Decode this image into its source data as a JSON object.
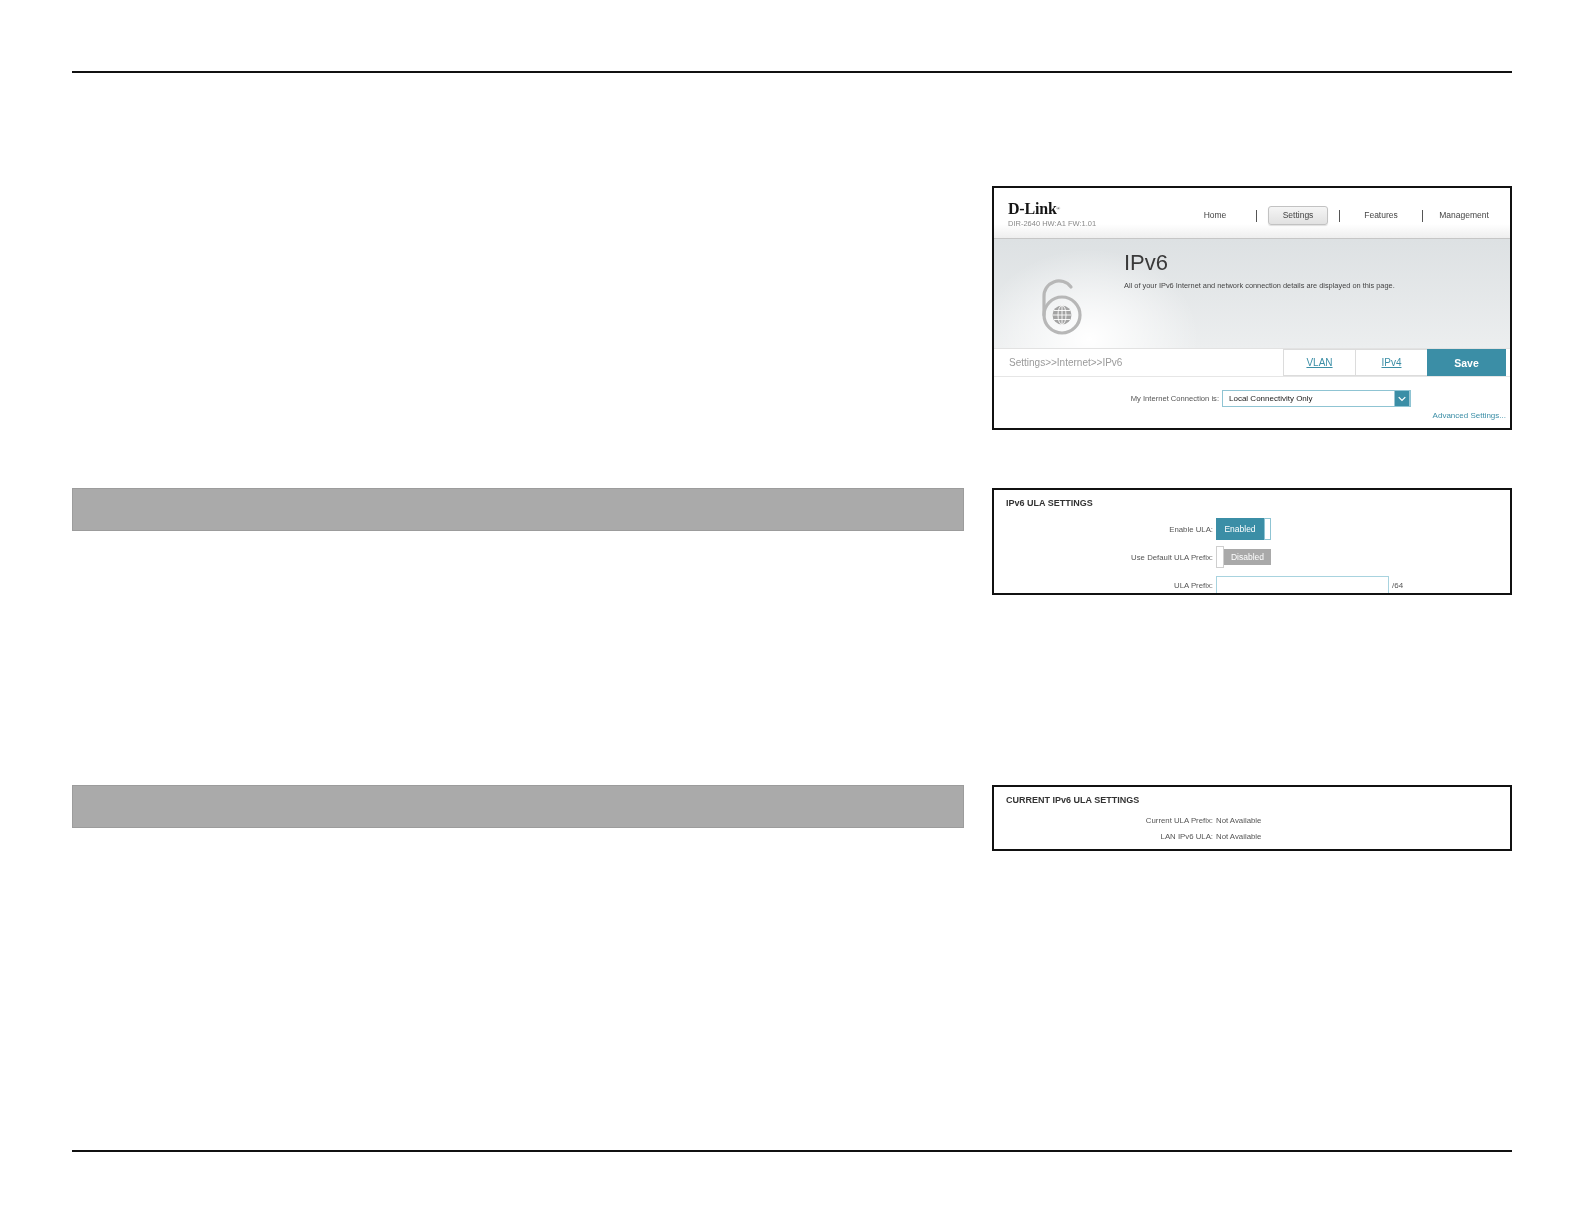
{
  "router_ui": {
    "header": {
      "logo": "D-Link$^{®}$",
      "model": "DIR-2640 HW:A1 FW:1.01",
      "nav": [
        {
          "label": "Home",
          "selected": false
        },
        {
          "label": "Settings",
          "selected": true
        },
        {
          "label": "Features",
          "selected": false
        },
        {
          "label": "Management",
          "selected": false
        }
      ]
    },
    "banner": {
      "title": "IPv6",
      "description": "All of your IPv6 Internet and network connection details are displayed on this page."
    },
    "breadcrumb": "Settings>>Internet>>IPv6",
    "sub_pages": [
      {
        "label": "VLAN"
      },
      {
        "label": "IPv4"
      }
    ],
    "save_button": "Save",
    "connection": {
      "label": "My Internet Connection is:",
      "value": "Local Connectivity Only"
    },
    "advanced_link": "Advanced Settings..."
  },
  "ula_settings": {
    "title": "IPv6 ULA SETTINGS",
    "fields": [
      {
        "kind": "toggle",
        "label": "Enable ULA:",
        "on": true,
        "state_text": "Enabled"
      },
      {
        "kind": "toggle",
        "label": "Use Default ULA Prefix:",
        "on": false,
        "state_text": "Disabled"
      },
      {
        "kind": "text",
        "label": "ULA Prefix:",
        "suffix": "/64"
      }
    ]
  },
  "current_ula": {
    "title": "CURRENT IPv6 ULA SETTINGS",
    "rows": [
      {
        "label": "Current ULA Prefix:",
        "value": "Not Available"
      },
      {
        "label": "LAN IPv6 ULA:",
        "value": "Not Available"
      }
    ]
  }
}
